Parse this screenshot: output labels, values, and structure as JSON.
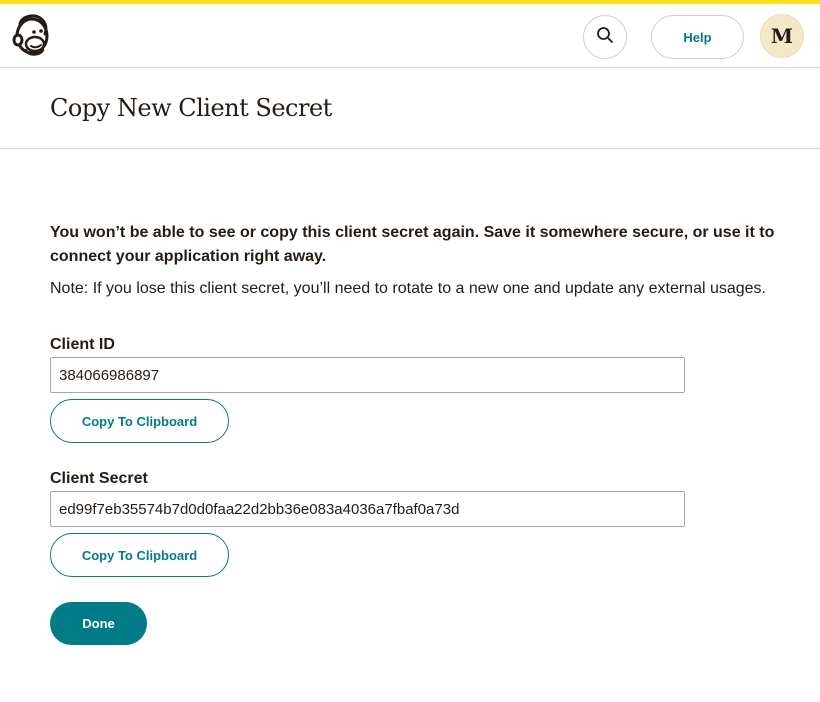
{
  "colors": {
    "accent_bar": "#ffe01b",
    "brand_teal": "#007c89",
    "text": "#241c15",
    "border": "#d9d9d9"
  },
  "header": {
    "logo_icon": "freddie-logo-icon",
    "search_icon": "search-icon",
    "help_label": "Help",
    "avatar_initial": "M"
  },
  "page": {
    "title": "Copy New Client Secret",
    "warning": "You won’t be able to see or copy this client secret again. Save it somewhere secure, or use it to connect your application right away.",
    "note": "Note: If you lose this client secret, you’ll need to rotate to a new one and update any external usages."
  },
  "client_id": {
    "label": "Client ID",
    "value": "384066986897",
    "copy_label": "Copy To Clipboard"
  },
  "client_secret": {
    "label": "Client Secret",
    "value": "ed99f7eb35574b7d0d0faa22d2bb36e083a4036a7fbaf0a73d",
    "copy_label": "Copy To Clipboard"
  },
  "actions": {
    "done_label": "Done"
  }
}
